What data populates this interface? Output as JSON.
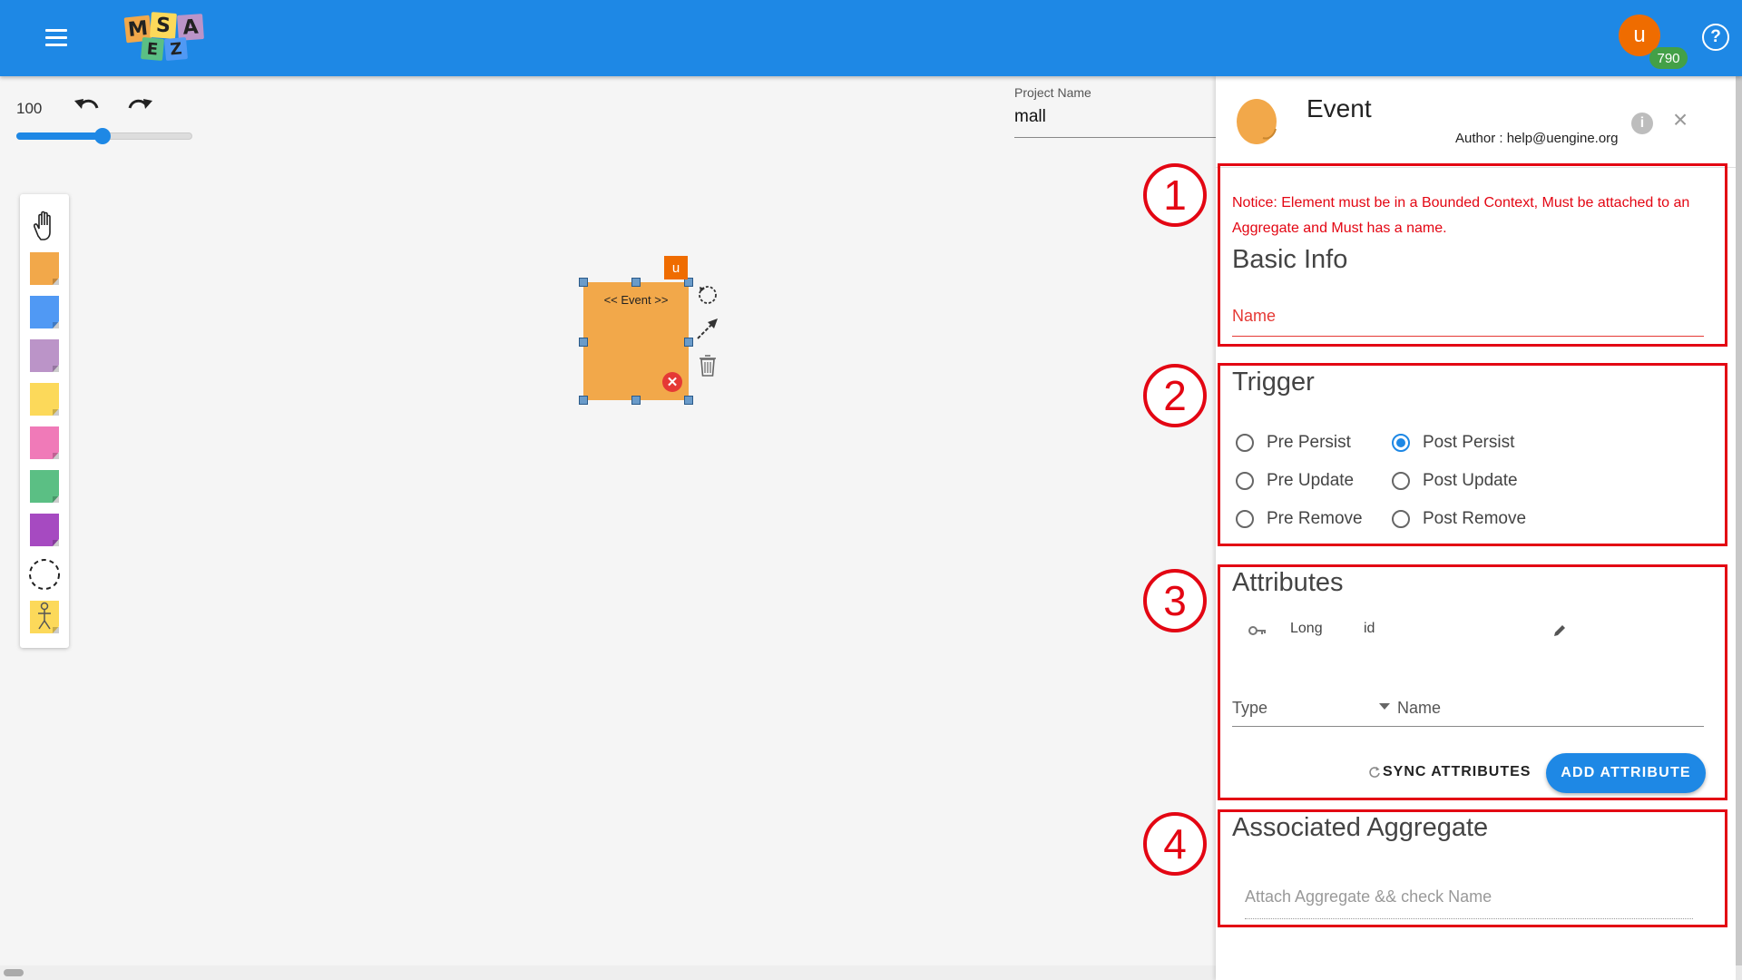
{
  "app": {
    "logo_letters": [
      "M",
      "S",
      "A",
      "E",
      "Z"
    ],
    "logo_text": "MSA EZ"
  },
  "user": {
    "initial": "u",
    "points": "790"
  },
  "toolbar": {
    "zoom": "100",
    "zoom_fraction": 0.5
  },
  "project": {
    "label": "Project Name",
    "value": "mall"
  },
  "palette": {
    "items": [
      {
        "name": "hand-tool",
        "color": ""
      },
      {
        "name": "event-sticker",
        "color": "#f2a84a"
      },
      {
        "name": "command-sticker",
        "color": "#5099f4"
      },
      {
        "name": "policy-sticker",
        "color": "#bb94c8"
      },
      {
        "name": "aggregate-sticker",
        "color": "#fcd95a"
      },
      {
        "name": "external-sticker",
        "color": "#f07ab8"
      },
      {
        "name": "readmodel-sticker",
        "color": "#5bbf84"
      },
      {
        "name": "ui-sticker",
        "color": "#a64ac1"
      },
      {
        "name": "bounded-context-tool",
        "color": ""
      },
      {
        "name": "actor-sticker",
        "color": "#fcd95a"
      }
    ]
  },
  "canvas": {
    "event": {
      "label": "<< Event >>",
      "user_tag": "u",
      "color": "#f2a84a"
    }
  },
  "panel": {
    "title": "Event",
    "author": "Author : help@uengine.org",
    "icon_color": "#f2a84a",
    "notice": "Notice: Element must be in a Bounded Context, Must be attached to an Aggregate and Must has a name.",
    "basic_info": {
      "title": "Basic Info",
      "name_label": "Name"
    },
    "trigger": {
      "title": "Trigger",
      "options": [
        {
          "label": "Pre Persist",
          "checked": false
        },
        {
          "label": "Post Persist",
          "checked": true
        },
        {
          "label": "Pre Update",
          "checked": false
        },
        {
          "label": "Post Update",
          "checked": false
        },
        {
          "label": "Pre Remove",
          "checked": false
        },
        {
          "label": "Post Remove",
          "checked": false
        }
      ]
    },
    "attributes": {
      "title": "Attributes",
      "rows": [
        {
          "type": "Long",
          "name": "id",
          "is_key": true
        }
      ],
      "type_label": "Type",
      "name_label": "Name",
      "sync_label": "SYNC ATTRIBUTES",
      "add_label": "ADD ATTRIBUTE"
    },
    "associated_aggregate": {
      "title": "Associated Aggregate",
      "placeholder": "Attach Aggregate && check Name"
    }
  },
  "annotations": {
    "numbers": [
      "1",
      "2",
      "3",
      "4"
    ],
    "color": "#e30613"
  }
}
